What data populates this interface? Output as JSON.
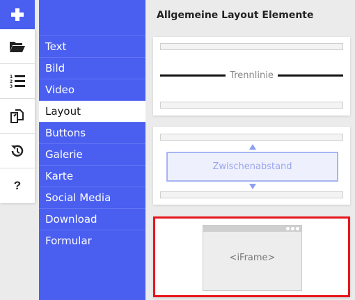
{
  "rail": {
    "add_icon": "plus-icon",
    "buttons": [
      {
        "name": "folder-open-icon"
      },
      {
        "name": "numbered-list-icon"
      },
      {
        "name": "copy-pages-icon"
      },
      {
        "name": "history-icon"
      },
      {
        "name": "help-icon",
        "label": "?"
      }
    ]
  },
  "categories": [
    {
      "label": "Text"
    },
    {
      "label": "Bild"
    },
    {
      "label": "Video"
    },
    {
      "label": "Layout",
      "active": true
    },
    {
      "label": "Buttons"
    },
    {
      "label": "Galerie"
    },
    {
      "label": "Karte"
    },
    {
      "label": "Social Media"
    },
    {
      "label": "Download"
    },
    {
      "label": "Formular"
    }
  ],
  "main": {
    "heading": "Allgemeine Layout Elemente",
    "cards": {
      "divider": {
        "label": "Trennlinie"
      },
      "spacer": {
        "label": "Zwischenabstand"
      },
      "iframe": {
        "label": "<iFrame>"
      }
    }
  },
  "colors": {
    "brand_blue": "#4a5ff0",
    "selection_red": "#e8151b",
    "spacer_blue": "#a7b4f4"
  }
}
